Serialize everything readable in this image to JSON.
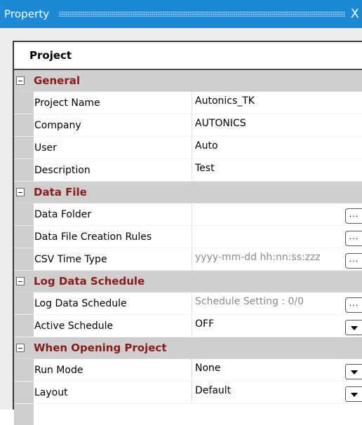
{
  "window": {
    "title": "Property",
    "close_label": "X"
  },
  "panel": {
    "header": "Project"
  },
  "categories": [
    {
      "label": "General",
      "properties": [
        {
          "name": "Project Name",
          "value": "Autonics_TK",
          "editor": "none"
        },
        {
          "name": "Company",
          "value": "AUTONICS",
          "editor": "none"
        },
        {
          "name": "User",
          "value": "Auto",
          "editor": "none"
        },
        {
          "name": "Description",
          "value": "Test",
          "editor": "none"
        }
      ]
    },
    {
      "label": "Data File",
      "properties": [
        {
          "name": "Data Folder",
          "value": "",
          "editor": "ellipsis"
        },
        {
          "name": "Data File Creation Rules",
          "value": "",
          "editor": "ellipsis"
        },
        {
          "name": "CSV Time Type",
          "value": "yyyy-mm-dd hh:nn:ss:zzz",
          "editor": "ellipsis",
          "muted": true
        }
      ]
    },
    {
      "label": "Log Data Schedule",
      "properties": [
        {
          "name": "Log Data Schedule",
          "value": "Schedule Setting : 0/0",
          "editor": "ellipsis",
          "muted": true
        },
        {
          "name": "Active Schedule",
          "value": "OFF",
          "editor": "dropdown"
        }
      ]
    },
    {
      "label": "When Opening Project",
      "properties": [
        {
          "name": "Run Mode",
          "value": "None",
          "editor": "dropdown"
        },
        {
          "name": "Layout",
          "value": "Default",
          "editor": "dropdown"
        }
      ]
    }
  ],
  "buttons": {
    "ellipsis_label": "..."
  },
  "colors": {
    "titlebar": "#1e8ad6",
    "category_text": "#8b1a1a",
    "category_bg": "#cfcfcf",
    "muted_value": "#8a8a8a"
  }
}
